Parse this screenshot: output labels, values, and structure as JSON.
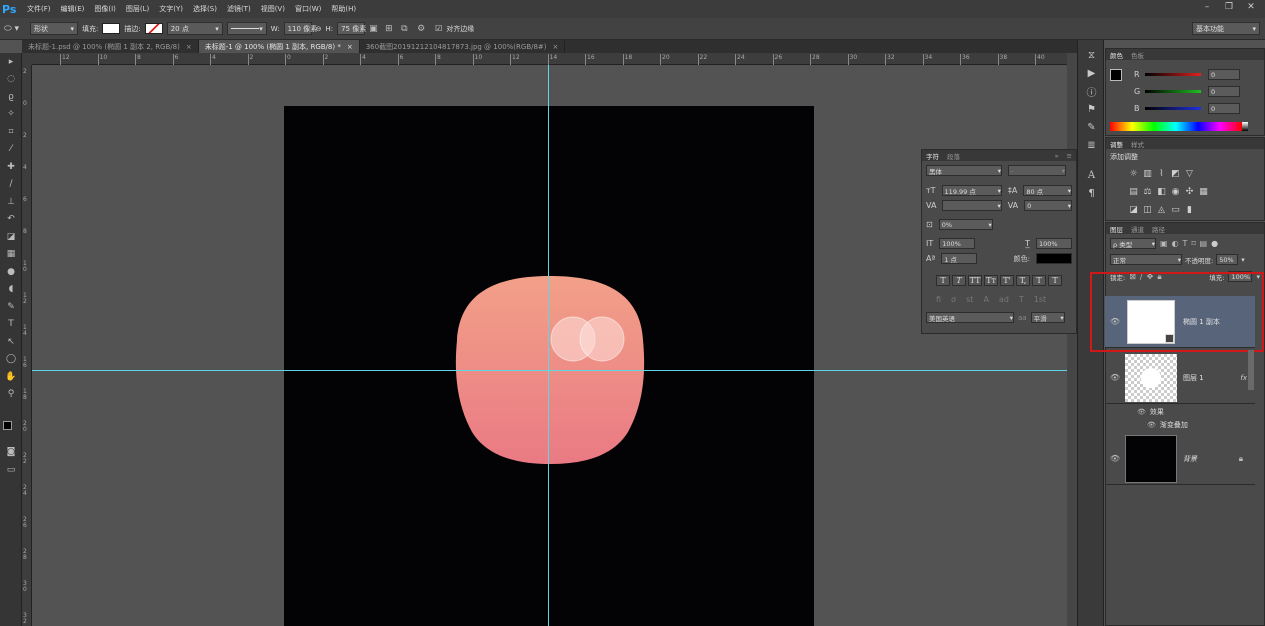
{
  "app": {
    "logo": "Ps",
    "workspace": "基本功能"
  },
  "menu": [
    "文件(F)",
    "编辑(E)",
    "图像(I)",
    "图层(L)",
    "文字(Y)",
    "选择(S)",
    "滤镜(T)",
    "视图(V)",
    "窗口(W)",
    "帮助(H)"
  ],
  "window_controls": {
    "minimize": "–",
    "restore": "❐",
    "close": "✕"
  },
  "options": {
    "shape_mode": "形状",
    "fill_label": "填充:",
    "stroke_label": "描边:",
    "stroke_width": "20 点",
    "w_label": "W:",
    "w_value": "110 像素",
    "link_symbol": "⊖",
    "h_label": "H:",
    "h_value": "75 像素",
    "align_edges_label": "对齐边缘",
    "align_edges_checked": true
  },
  "tabs": [
    {
      "label": "未标题-1.psd @ 100% (椭圆 1 副本 2, RGB/8)",
      "active": false
    },
    {
      "label": "未标题-1 @ 100% (椭圆 1 副本, RGB/8) *",
      "active": true
    },
    {
      "label": "360截图20191212104817873.jpg @ 100%(RGB/8#)",
      "active": false
    }
  ],
  "ruler_h_labels": [
    "12",
    "10",
    "8",
    "6",
    "4",
    "2",
    "0",
    "2",
    "4",
    "6",
    "8",
    "10",
    "12",
    "14",
    "16",
    "18",
    "20",
    "22",
    "24",
    "26",
    "28",
    "30",
    "32",
    "34",
    "36",
    "38",
    "40"
  ],
  "ruler_v_labels": [
    "2",
    "0",
    "2",
    "4",
    "6",
    "8",
    "1\n0",
    "1\n2",
    "1\n4",
    "1\n6",
    "1\n8",
    "2\n0",
    "2\n2",
    "2\n4",
    "2\n6",
    "2\n8",
    "3\n0",
    "3\n2"
  ],
  "tool_icons": [
    "move-icon",
    "marquee-icon",
    "lasso-icon",
    "magic-wand-icon",
    "crop-icon",
    "eyedropper-icon",
    "healing-icon",
    "brush-icon",
    "stamp-icon",
    "history-brush-icon",
    "eraser-icon",
    "gradient-icon",
    "blur-icon",
    "dodge-icon",
    "pen-icon",
    "type-icon",
    "path-select-icon",
    "ellipse-tool-icon",
    "hand-icon",
    "zoom-icon"
  ],
  "tool_glyphs": [
    "▸",
    "◌",
    "ϱ",
    "✧",
    "⌗",
    "⁄",
    "✚",
    "∕",
    "⊥",
    "↶",
    "◪",
    "▦",
    "●",
    "◖",
    "✎",
    "T",
    "↖",
    "◯",
    "✋",
    "⚲"
  ],
  "color_panel": {
    "tabs": [
      "颜色",
      "色板"
    ],
    "channels": [
      {
        "label": "R",
        "value": "0",
        "color": "#e02020"
      },
      {
        "label": "G",
        "value": "0",
        "color": "#20c020"
      },
      {
        "label": "B",
        "value": "0",
        "color": "#2030e0"
      }
    ]
  },
  "adjust_panel": {
    "tabs": [
      "调整",
      "样式"
    ],
    "title": "添加调整"
  },
  "char_panel": {
    "tabs": [
      "字符",
      "段落"
    ],
    "font": "黑体",
    "style": "-",
    "size": "119.99 点",
    "leading": "80 点",
    "kerning": "",
    "tracking": "0",
    "scale_pct": "0%",
    "v_scale": "100%",
    "h_scale": "100%",
    "baseline": "1 点",
    "color_label": "颜色:",
    "style_buttons": [
      "T",
      "T",
      "TT",
      "Tт",
      "T'",
      "T,",
      "T",
      "T"
    ],
    "language": "美国英语",
    "aa_label": "aa",
    "antialias": "平滑"
  },
  "layers_panel": {
    "tabs": [
      "图层",
      "通道",
      "路径"
    ],
    "filter_kind": "ρ 类型",
    "blend_mode": "正常",
    "opacity_label": "不透明度:",
    "opacity": "50%",
    "lock_label": "锁定:",
    "fill_label": "填充:",
    "fill": "100%",
    "layers": [
      {
        "name": "椭圆 1 副本",
        "selected": true
      },
      {
        "name": "图层 1",
        "fx": "fx"
      },
      {
        "name": "背景",
        "locked": true
      }
    ],
    "effects_label": "效果",
    "effect_item": "渐变叠加"
  },
  "canvas_colors": {
    "gradient_top": "#f2a088",
    "gradient_bottom": "#ea7a84",
    "background": "#030205",
    "guide": "#5ed6e6"
  }
}
